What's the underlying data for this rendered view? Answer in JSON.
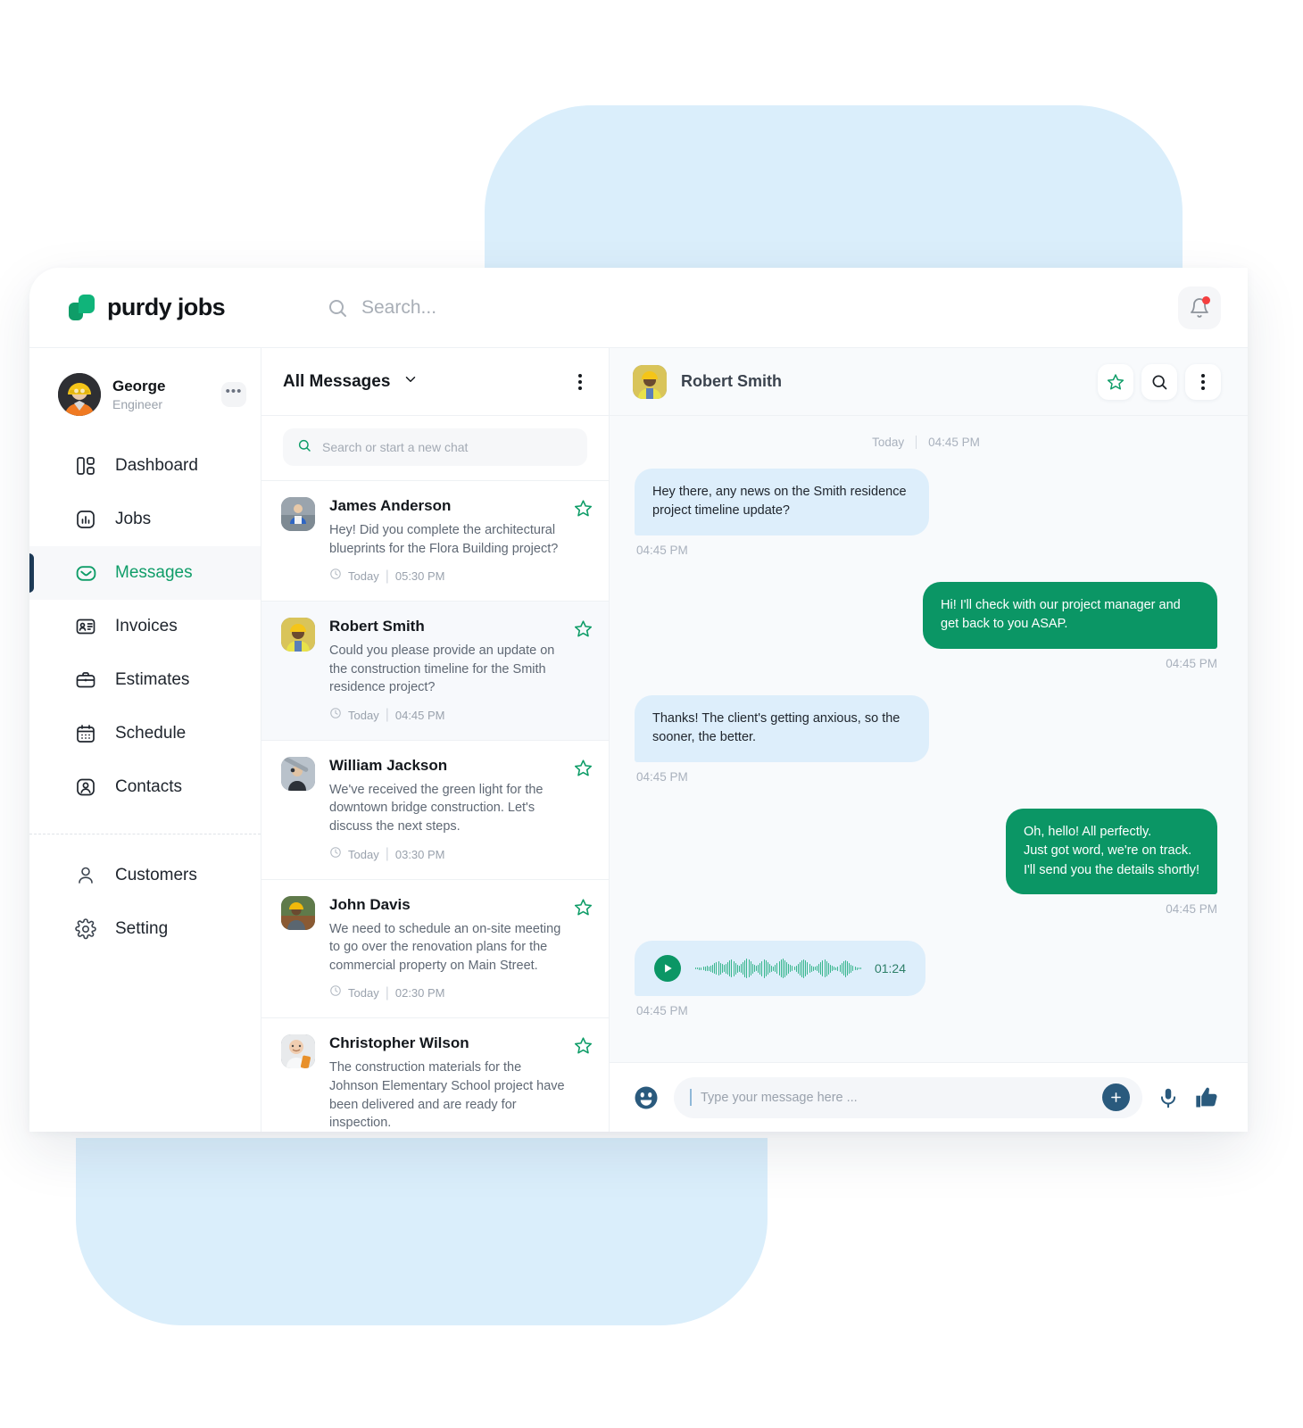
{
  "brand": {
    "name": "purdy jobs",
    "logo_icon": "purdy-logo-icon",
    "accent": "#0f9d68"
  },
  "topbar": {
    "search_placeholder": "Search...",
    "search_icon": "search-icon",
    "notification_icon": "bell-icon",
    "has_unread_badge": true
  },
  "sidebar": {
    "profile": {
      "name": "George",
      "role": "Engineer",
      "more_label": "•••"
    },
    "items": [
      {
        "label": "Dashboard",
        "icon": "dashboard-icon",
        "active": false
      },
      {
        "label": "Jobs",
        "icon": "jobs-icon",
        "active": false
      },
      {
        "label": "Messages",
        "icon": "envelope-icon",
        "active": true
      },
      {
        "label": "Invoices",
        "icon": "invoice-card-icon",
        "active": false
      },
      {
        "label": "Estimates",
        "icon": "briefcase-icon",
        "active": false
      },
      {
        "label": "Schedule",
        "icon": "calendar-icon",
        "active": false
      },
      {
        "label": "Contacts",
        "icon": "contact-person-icon",
        "active": false
      }
    ],
    "items_secondary": [
      {
        "label": "Customers",
        "icon": "user-icon",
        "active": false
      },
      {
        "label": "Setting",
        "icon": "gear-icon",
        "active": false
      }
    ]
  },
  "message_list": {
    "title": "All Messages",
    "dropdown_icon": "chevron-down-icon",
    "menu_icon": "kebab-menu-icon",
    "search_placeholder": "Search or start a new chat",
    "search_icon": "search-icon",
    "rows": [
      {
        "name": "James Anderson",
        "snippet": "Hey! Did you complete the architectural blueprints for the Flora Building project?",
        "day": "Today",
        "time": "05:30 PM",
        "starred": true,
        "selected": false
      },
      {
        "name": "Robert Smith",
        "snippet": "Could you please provide an update on the construction timeline for the Smith residence project?",
        "day": "Today",
        "time": "04:45 PM",
        "starred": true,
        "selected": true
      },
      {
        "name": "William Jackson",
        "snippet": "We've received the green light for the downtown bridge construction. Let's discuss the next steps.",
        "day": "Today",
        "time": "03:30 PM",
        "starred": true,
        "selected": false
      },
      {
        "name": "John Davis",
        "snippet": "We need to schedule an on-site meeting to go over the renovation plans for the commercial property on Main Street.",
        "day": "Today",
        "time": "02:30 PM",
        "starred": true,
        "selected": false
      },
      {
        "name": "Christopher Wilson",
        "snippet": "The construction materials for the Johnson Elementary School project have been delivered and are ready for inspection.",
        "day": "",
        "time": "",
        "starred": true,
        "selected": false
      }
    ]
  },
  "chat": {
    "peer_name": "Robert Smith",
    "star_icon": "star-icon",
    "search_icon": "search-icon",
    "menu_icon": "kebab-menu-icon",
    "daystamp": {
      "day": "Today",
      "time": "04:45 PM"
    },
    "messages": [
      {
        "kind": "text",
        "side": "in",
        "text": "Hey there, any news on the Smith residence project timeline update?",
        "time": "04:45 PM"
      },
      {
        "kind": "text",
        "side": "out",
        "text": "Hi! I'll check with our project manager and get back to you ASAP.",
        "time": "04:45 PM"
      },
      {
        "kind": "text",
        "side": "in",
        "text": "Thanks! The client's getting anxious, so the sooner, the better.",
        "time": "04:45 PM"
      },
      {
        "kind": "text",
        "side": "out",
        "text": "Oh, hello! All perfectly.\nJust got word, we're on track.\nI'll send you the details shortly!",
        "time": "04:45 PM"
      },
      {
        "kind": "voice",
        "side": "in",
        "duration": "01:24",
        "play_icon": "play-icon",
        "time": "04:45 PM"
      }
    ],
    "composer": {
      "emoji_icon": "emoji-icon",
      "placeholder": "Type your message here ...",
      "value": "",
      "attach_icon": "plus-icon",
      "mic_icon": "microphone-icon",
      "thumb_icon": "thumbs-up-icon"
    }
  },
  "colors": {
    "accent_green": "#0b9665",
    "bubble_in": "#ddeefb",
    "bubble_out": "#0b9665",
    "navy": "#1d3a56",
    "backdrop_blue": "#daeefb",
    "badge_red": "#f43f3f"
  }
}
